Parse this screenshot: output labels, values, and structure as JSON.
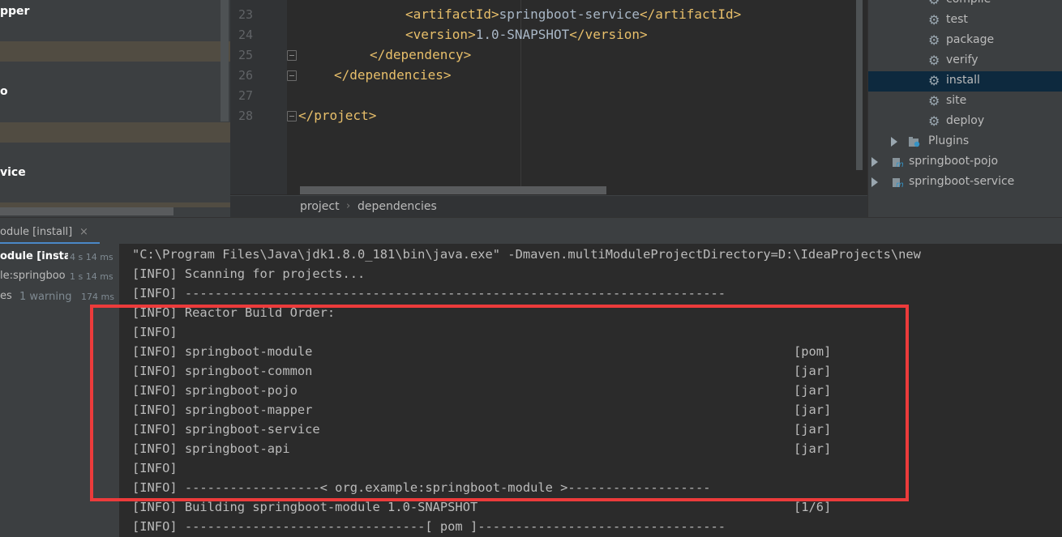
{
  "left_panel": {
    "items": [
      "pper",
      "o",
      "vice"
    ]
  },
  "editor": {
    "lines": [
      {
        "num": "23",
        "indent": 12,
        "open": "<artifactId>",
        "text": "springboot-service",
        "close": "</artifactId>"
      },
      {
        "num": "24",
        "indent": 12,
        "open": "<version>",
        "text": "1.0-SNAPSHOT",
        "close": "</version>"
      },
      {
        "num": "25",
        "indent": 8,
        "open": "</dependency>",
        "text": "",
        "close": ""
      },
      {
        "num": "26",
        "indent": 4,
        "open": "</dependencies>",
        "text": "",
        "close": ""
      },
      {
        "num": "27",
        "indent": 0,
        "open": "",
        "text": "",
        "close": ""
      },
      {
        "num": "28",
        "indent": 0,
        "open": "</project>",
        "text": "",
        "close": ""
      }
    ],
    "breadcrumb": [
      "project",
      "dependencies"
    ]
  },
  "maven": {
    "lifecycle": [
      "compile",
      "test",
      "package",
      "verify",
      "install",
      "site",
      "deploy"
    ],
    "selected": "install",
    "plugins_label": "Plugins",
    "modules": [
      "springboot-pojo",
      "springboot-service"
    ]
  },
  "run": {
    "tab_label": "odule [install]",
    "tab_close": "×",
    "tree": [
      {
        "name": "odule [insta",
        "time": "4 s 14 ms",
        "bold": true
      },
      {
        "name": "le:springboo",
        "time": "1 s 14 ms",
        "bold": false
      },
      {
        "name": "es",
        "warning": "1 warning",
        "time": "174 ms",
        "bold": false
      }
    ],
    "console_lines": [
      {
        "text": "\"C:\\Program Files\\Java\\jdk1.8.0_181\\bin\\java.exe\" -Dmaven.multiModuleProjectDirectory=D:\\IdeaProjects\\new",
        "right": ""
      },
      {
        "text": "[INFO] Scanning for projects...",
        "right": ""
      },
      {
        "text": "[INFO] ------------------------------------------------------------------------",
        "right": ""
      },
      {
        "text": "[INFO] Reactor Build Order:",
        "right": ""
      },
      {
        "text": "[INFO]",
        "right": ""
      },
      {
        "text": "[INFO] springboot-module",
        "right": "[pom]"
      },
      {
        "text": "[INFO] springboot-common",
        "right": "[jar]"
      },
      {
        "text": "[INFO] springboot-pojo",
        "right": "[jar]"
      },
      {
        "text": "[INFO] springboot-mapper",
        "right": "[jar]"
      },
      {
        "text": "[INFO] springboot-service",
        "right": "[jar]"
      },
      {
        "text": "[INFO] springboot-api",
        "right": "[jar]"
      },
      {
        "text": "[INFO]",
        "right": ""
      },
      {
        "text": "[INFO] ------------------< org.example:springboot-module >-------------------",
        "right": ""
      },
      {
        "text": "[INFO] Building springboot-module 1.0-SNAPSHOT",
        "right": "[1/6]"
      },
      {
        "text": "[INFO] --------------------------------[ pom ]---------------------------------",
        "right": ""
      }
    ]
  },
  "colors": {
    "highlight": "#ec3b3b",
    "selection": "#0d293e",
    "tag": "#e8bf6a",
    "accent": "#4a88c7"
  }
}
